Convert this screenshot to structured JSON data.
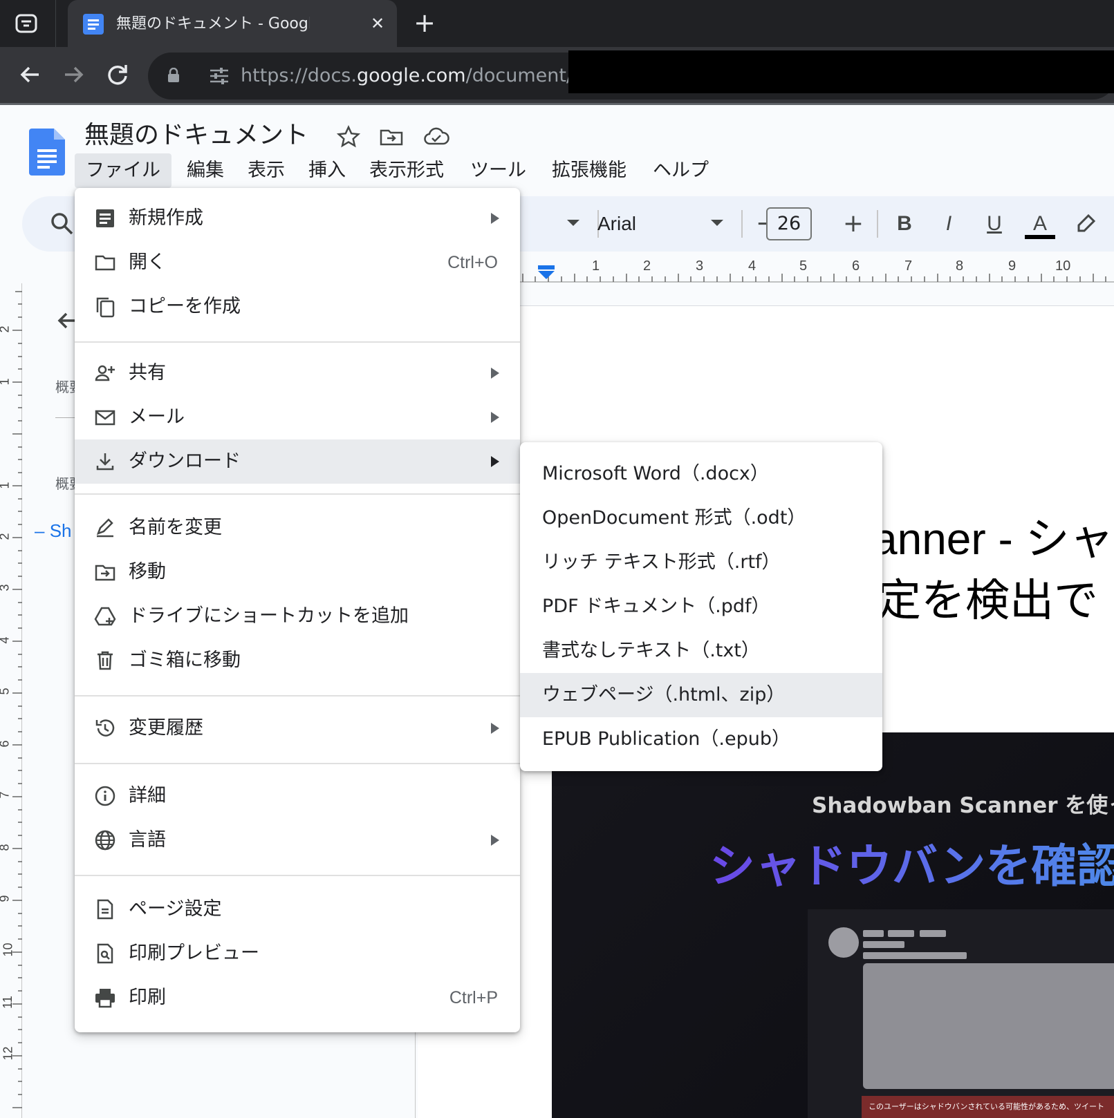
{
  "browser": {
    "tab_title": "無題のドキュメント - Google ドキ",
    "url_prefix": "https://docs.",
    "url_domain": "google.com",
    "url_path": "/document/d/"
  },
  "docs": {
    "title": "無題のドキュメント",
    "menus": [
      "ファイル",
      "編集",
      "表示",
      "挿入",
      "表示形式",
      "ツール",
      "拡張機能",
      "ヘルプ"
    ],
    "font": "Arial",
    "font_size": "26",
    "fmt_bold": "B",
    "fmt_italic": "I",
    "fmt_underline": "U",
    "fmt_color": "A",
    "ruler": [
      "1",
      "2",
      "3",
      "4",
      "5",
      "6",
      "7",
      "8",
      "9",
      "10"
    ],
    "vruler": [
      "2",
      "1",
      "1",
      "2",
      "3",
      "4",
      "5",
      "6",
      "7",
      "8",
      "9",
      "10",
      "11",
      "12"
    ]
  },
  "outline": {
    "label1": "概要",
    "label2": "概要",
    "heading": "Sh"
  },
  "document": {
    "heading_line1": "anner - シャ",
    "heading_line2": "定を検出で",
    "banner_top": "Shadowban Scanner を使って",
    "banner_big": "シャドウバンを確認し",
    "banner_caption": "このユーザーはシャドウバンされている可能性があるため、ツイート"
  },
  "file_menu": {
    "items": [
      {
        "label": "新規作成",
        "icon": "doc-icon",
        "submenu": true
      },
      {
        "label": "開く",
        "icon": "folder-icon",
        "shortcut": "Ctrl+O"
      },
      {
        "label": "コピーを作成",
        "icon": "copy-icon"
      },
      {
        "label": "共有",
        "icon": "person-add-icon",
        "submenu": true
      },
      {
        "label": "メール",
        "icon": "mail-icon",
        "submenu": true
      },
      {
        "label": "ダウンロード",
        "icon": "download-icon",
        "submenu": true,
        "highlighted": true
      },
      {
        "label": "名前を変更",
        "icon": "rename-icon"
      },
      {
        "label": "移動",
        "icon": "move-folder-icon"
      },
      {
        "label": "ドライブにショートカットを追加",
        "icon": "drive-shortcut-icon"
      },
      {
        "label": "ゴミ箱に移動",
        "icon": "trash-icon"
      },
      {
        "label": "変更履歴",
        "icon": "history-icon",
        "submenu": true
      },
      {
        "label": "詳細",
        "icon": "info-icon"
      },
      {
        "label": "言語",
        "icon": "globe-icon",
        "submenu": true
      },
      {
        "label": "ページ設定",
        "icon": "page-setup-icon"
      },
      {
        "label": "印刷プレビュー",
        "icon": "print-preview-icon"
      },
      {
        "label": "印刷",
        "icon": "print-icon",
        "shortcut": "Ctrl+P"
      }
    ]
  },
  "download_menu": {
    "items": [
      {
        "label": "Microsoft Word（.docx）"
      },
      {
        "label": "OpenDocument 形式（.odt）"
      },
      {
        "label": "リッチ テキスト形式（.rtf）"
      },
      {
        "label": "PDF ドキュメント（.pdf）"
      },
      {
        "label": "書式なしテキスト（.txt）"
      },
      {
        "label": "ウェブページ（.html、zip）",
        "highlighted": true
      },
      {
        "label": "EPUB Publication（.epub）"
      }
    ]
  }
}
